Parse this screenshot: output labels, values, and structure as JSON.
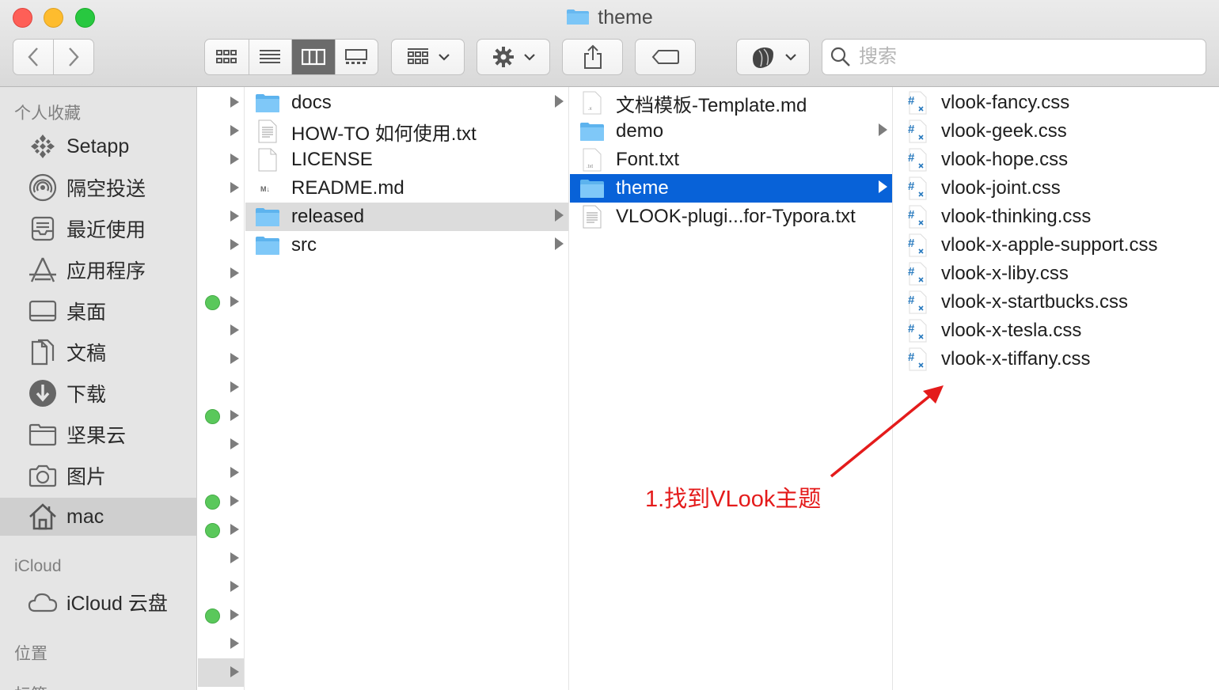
{
  "window": {
    "title": "theme"
  },
  "toolbar": {
    "search_placeholder": "搜索",
    "view_modes": [
      "icon-view",
      "list-view",
      "column-view",
      "gallery-view"
    ],
    "active_view": "column-view"
  },
  "sidebar": {
    "sections": {
      "favorites": "个人收藏",
      "icloud": "iCloud",
      "locations": "位置",
      "tags_partial": "标签"
    },
    "favorites": [
      {
        "label": "Setapp",
        "icon": "setapp-icon"
      },
      {
        "label": "隔空投送",
        "icon": "airdrop-icon"
      },
      {
        "label": "最近使用",
        "icon": "recents-icon"
      },
      {
        "label": "应用程序",
        "icon": "applications-icon"
      },
      {
        "label": "桌面",
        "icon": "desktop-icon"
      },
      {
        "label": "文稿",
        "icon": "documents-icon"
      },
      {
        "label": "下载",
        "icon": "downloads-icon"
      },
      {
        "label": "坚果云",
        "icon": "folder-icon"
      },
      {
        "label": "图片",
        "icon": "camera-icon"
      },
      {
        "label": "mac",
        "icon": "home-icon",
        "selected": true
      }
    ],
    "icloud_items": [
      {
        "label": "iCloud 云盘",
        "icon": "cloud-icon"
      }
    ]
  },
  "column2": [
    {
      "name": "docs",
      "type": "folder",
      "arrow": true
    },
    {
      "name": "HOW-TO 如何使用.txt",
      "type": "txt"
    },
    {
      "name": "LICENSE",
      "type": "blank"
    },
    {
      "name": "README.md",
      "type": "md"
    },
    {
      "name": "released",
      "type": "folder",
      "arrow": true,
      "highlight": "gray"
    },
    {
      "name": "src",
      "type": "folder",
      "arrow": true
    }
  ],
  "column3": [
    {
      "name": "文档模板-Template.md",
      "type": "doc"
    },
    {
      "name": "demo",
      "type": "folder",
      "arrow": true
    },
    {
      "name": "Font.txt",
      "type": "txt"
    },
    {
      "name": "theme",
      "type": "folder",
      "arrow": true,
      "highlight": "blue"
    },
    {
      "name": "VLOOK-plugi...for-Typora.txt",
      "type": "txt"
    }
  ],
  "column4": [
    "vlook-fancy.css",
    "vlook-geek.css",
    "vlook-hope.css",
    "vlook-joint.css",
    "vlook-thinking.css",
    "vlook-x-apple-support.css",
    "vlook-x-liby.css",
    "vlook-x-startbucks.css",
    "vlook-x-tesla.css",
    "vlook-x-tiffany.css"
  ],
  "column1_green_dots": [
    7,
    11,
    14,
    15,
    18
  ],
  "annotation": {
    "text": "1.找到VLook主题",
    "color": "#e41b1b"
  },
  "colors": {
    "selection_blue": "#0862d8",
    "tag_green": "#5ac85b"
  }
}
